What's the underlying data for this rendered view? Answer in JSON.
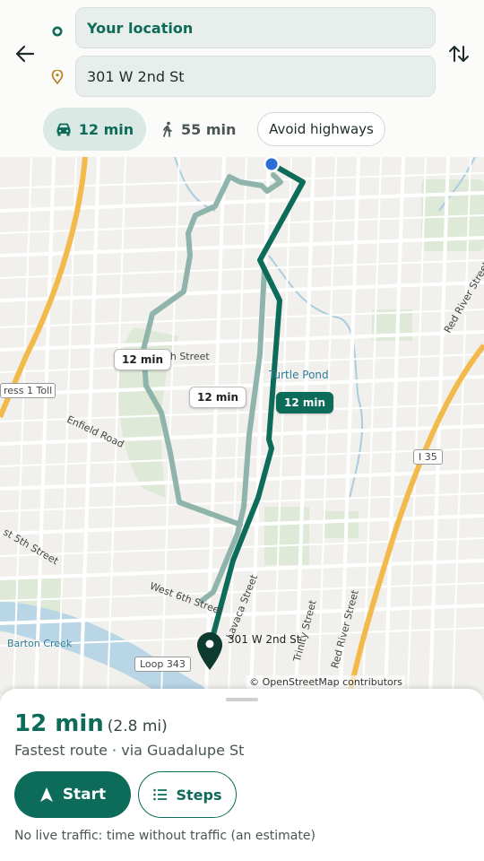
{
  "header": {
    "origin_value": "Your location",
    "destination_value": "301 W 2nd St",
    "icons": {
      "back": "arrow-left-icon",
      "swap": "swap-vertical-icon",
      "origin": "origin-circle-icon",
      "destination": "destination-pin-icon"
    }
  },
  "modes": {
    "car": {
      "label": "12 min",
      "icon": "car-icon",
      "selected": true
    },
    "walk": {
      "label": "55 min",
      "icon": "walk-icon",
      "selected": false
    },
    "avoid_highways": "Avoid highways"
  },
  "map": {
    "labels": {
      "street_24th": "st 24th Street",
      "turtle_pond": "Turtle Pond",
      "press_toll": "ress 1 Toll",
      "enfield": "Enfield Road",
      "i35": "I 35",
      "fifth": "st 5th Street",
      "sixth": "West 6th Street",
      "lavaca": "Lavaca Street",
      "trinity": "Trinity Street",
      "red_river_low": "Red River Street",
      "red_river_top": "Red River Street",
      "barton_creek": "Barton Creek",
      "loop343": "Loop 343",
      "destination": "301 W 2nd St"
    },
    "route_labels": {
      "alt_left": "12 min",
      "alt_mid": "12 min",
      "main": "12 min"
    },
    "attribution": "© OpenStreetMap contributors"
  },
  "sheet": {
    "duration": "12 min",
    "distance": "(2.8 mi)",
    "description": "Fastest route · via Guadalupe St",
    "start_label": "Start",
    "steps_label": "Steps",
    "traffic_note": "No live traffic: time without traffic (an estimate)"
  },
  "colors": {
    "accent": "#0c6b59",
    "alt_route": "#8fb4ab",
    "location_dot": "#2a6fd6",
    "highway": "#f2b94b"
  }
}
